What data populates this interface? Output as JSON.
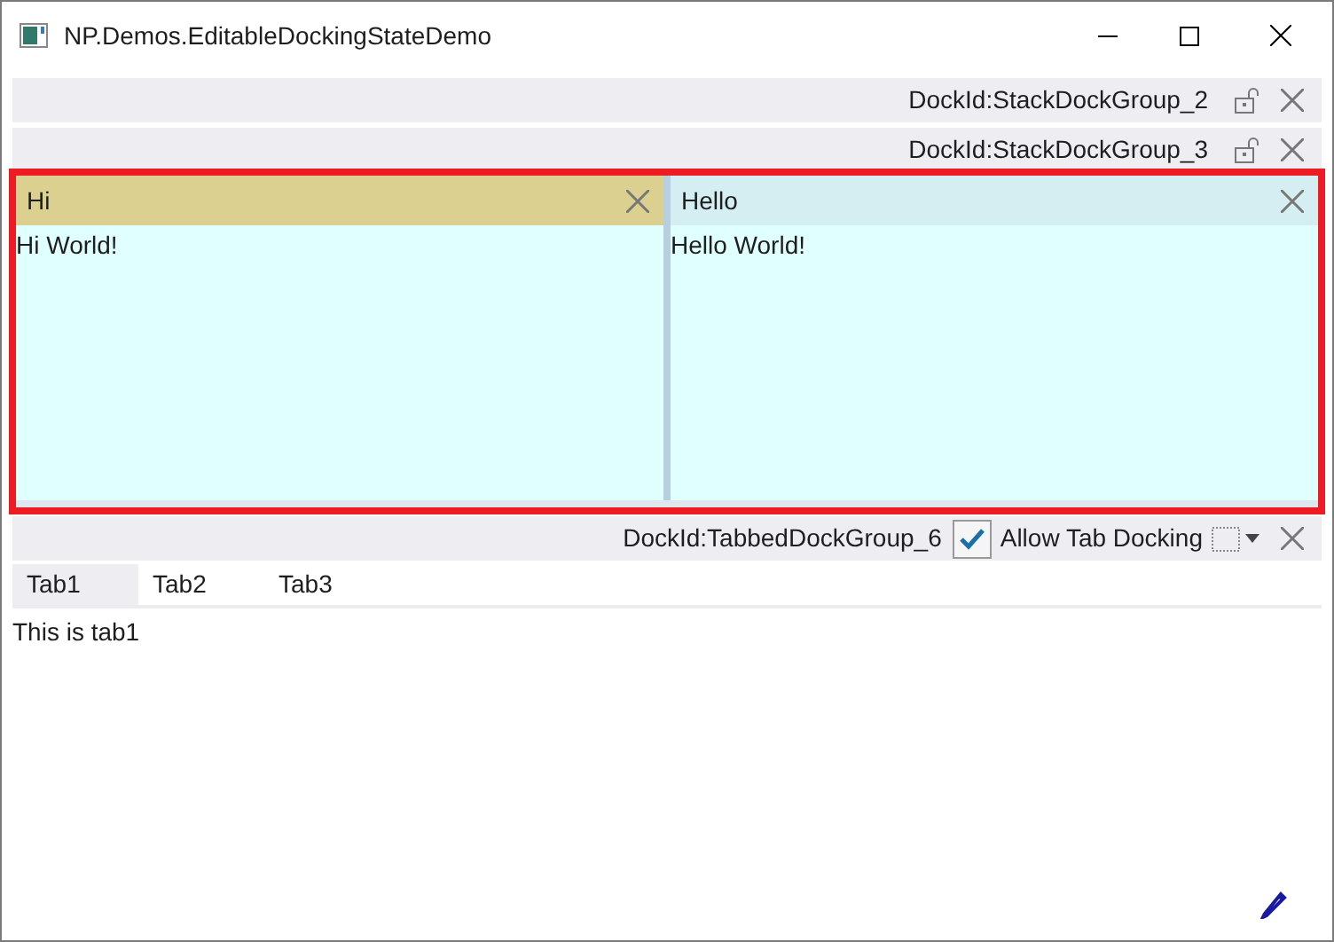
{
  "window": {
    "title": "NP.Demos.EditableDockingStateDemo"
  },
  "stack_groups": [
    {
      "dock_id": "DockId:StackDockGroup_2"
    },
    {
      "dock_id": "DockId:StackDockGroup_3"
    }
  ],
  "panels": [
    {
      "title": "Hi",
      "content": "Hi World!",
      "active": true
    },
    {
      "title": "Hello",
      "content": "Hello World!",
      "active": false
    }
  ],
  "tabbed_group": {
    "dock_id": "DockId:TabbedDockGroup_6",
    "allow_tab_docking": {
      "label": "Allow Tab Docking",
      "checked": true
    },
    "tabs": [
      {
        "label": "Tab1",
        "selected": true
      },
      {
        "label": "Tab2",
        "selected": false
      },
      {
        "label": "Tab3",
        "selected": false
      }
    ],
    "content": "This is tab1"
  }
}
